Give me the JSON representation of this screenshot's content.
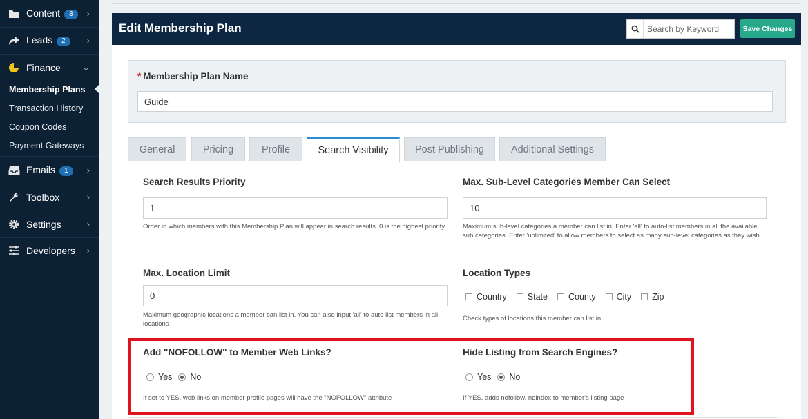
{
  "sidebar": {
    "items": [
      {
        "label": "Content",
        "badge": "3",
        "icon": "folder-icon"
      },
      {
        "label": "Leads",
        "badge": "2",
        "icon": "share-icon"
      },
      {
        "label": "Finance",
        "icon": "pie-chart-icon"
      },
      {
        "label": "Emails",
        "badge": "1",
        "icon": "inbox-icon"
      },
      {
        "label": "Toolbox",
        "icon": "wrench-icon"
      },
      {
        "label": "Settings",
        "icon": "gear-icon"
      },
      {
        "label": "Developers",
        "icon": "sliders-icon"
      }
    ],
    "finance_sub": [
      "Membership Plans",
      "Transaction History",
      "Coupon Codes",
      "Payment Gateways"
    ]
  },
  "header": {
    "title": "Edit Membership Plan",
    "search_placeholder": "Search by Keyword",
    "save_label": "Save Changes"
  },
  "plan": {
    "name_label": "Membership Plan Name",
    "name_value": "Guide"
  },
  "tabs": [
    "General",
    "Pricing",
    "Profile",
    "Search Visibility",
    "Post Publishing",
    "Additional Settings"
  ],
  "fields": {
    "priority": {
      "label": "Search Results Priority",
      "value": "1",
      "help": "Order in which members with this Membership Plan will appear in search results. 0 is the highest priority."
    },
    "max_sub": {
      "label": "Max. Sub-Level Categories Member Can Select",
      "value": "10",
      "help": "Maximum sub-level categories a member can list in. Enter 'all' to auto-list members in all the available sub categories. Enter 'unlimited' to allow members to select as many sub-level categories as they wish."
    },
    "max_location": {
      "label": "Max. Location Limit",
      "value": "0",
      "help": "Maximum geographic locations a member can list in. You can also input 'all' to auto list members in all locations"
    },
    "location_types": {
      "label": "Location Types",
      "options": [
        "Country",
        "State",
        "County",
        "City",
        "Zip"
      ],
      "help": "Check types of locations this member can list in"
    },
    "nofollow": {
      "label": "Add \"NOFOLLOW\" to Member Web Links?",
      "yes": "Yes",
      "no": "No",
      "help": "If set to YES, web links on member profile pages will have the \"NOFOLLOW\" attribute"
    },
    "hide_listing": {
      "label": "Hide Listing from Search Engines?",
      "yes": "Yes",
      "no": "No",
      "help": "If YES, adds nofollow, noindex to member's listing page"
    }
  },
  "colors": {
    "sidebar_bg": "#0d2135",
    "header_bg": "#0d2742",
    "save_button": "#27a88a",
    "highlight": "#e0141e"
  }
}
